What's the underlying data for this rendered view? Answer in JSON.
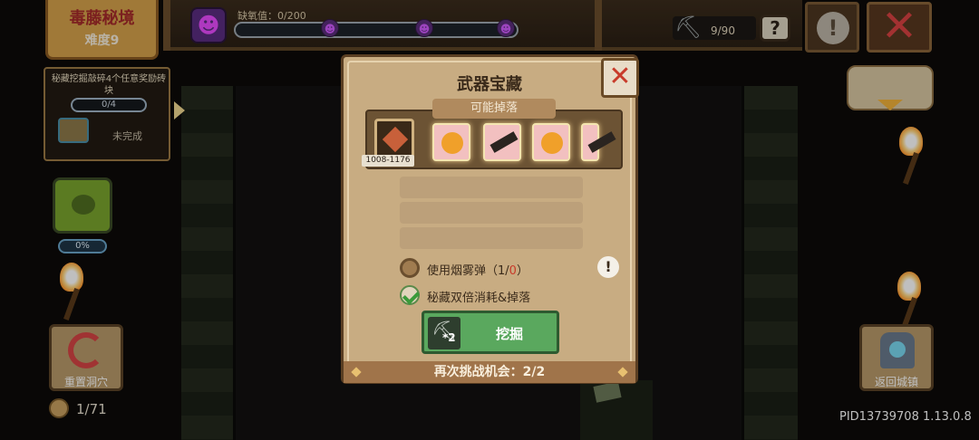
{
  "hud": {
    "level_name": "毒藤秘境",
    "difficulty": "难度9",
    "oxygen_label": "缺氧值：0/200",
    "oxygen_value": 0,
    "oxygen_max": 200,
    "pickaxe_count": "9/90",
    "help_icon": "?",
    "alert_icon": "!",
    "close_icon": "✕"
  },
  "quest": {
    "description": "秘藏挖掘敲碎4个任意奖励砖块",
    "progress": "0/4",
    "status": "未完成"
  },
  "poison": {
    "percent": "0%"
  },
  "left_buttons": {
    "reset_label": "重置洞穴",
    "coin_count": "1/71"
  },
  "right_buttons": {
    "home_label": "返回城镇"
  },
  "footer": {
    "pid": "PID13739708 1.13.0.8"
  },
  "dialog": {
    "title": "武器宝藏",
    "subtitle": "可能掉落",
    "close_icon": "✕",
    "drop_range": "1008-1176",
    "options": [
      {
        "label_prefix": "使用烟雾弹（1/",
        "label_red": "0",
        "label_suffix": "）",
        "checked": false
      },
      {
        "label": "秘藏双倍消耗&掉落",
        "checked": true
      }
    ],
    "info_icon": "!",
    "dig_multiplier": "*2",
    "dig_label": "挖掘",
    "retry_text": "再次挑战机会：2/2"
  },
  "colors": {
    "dig_button": "#5aa85e",
    "close_red": "#d84242",
    "dialog_bg": "#c8ac82"
  }
}
